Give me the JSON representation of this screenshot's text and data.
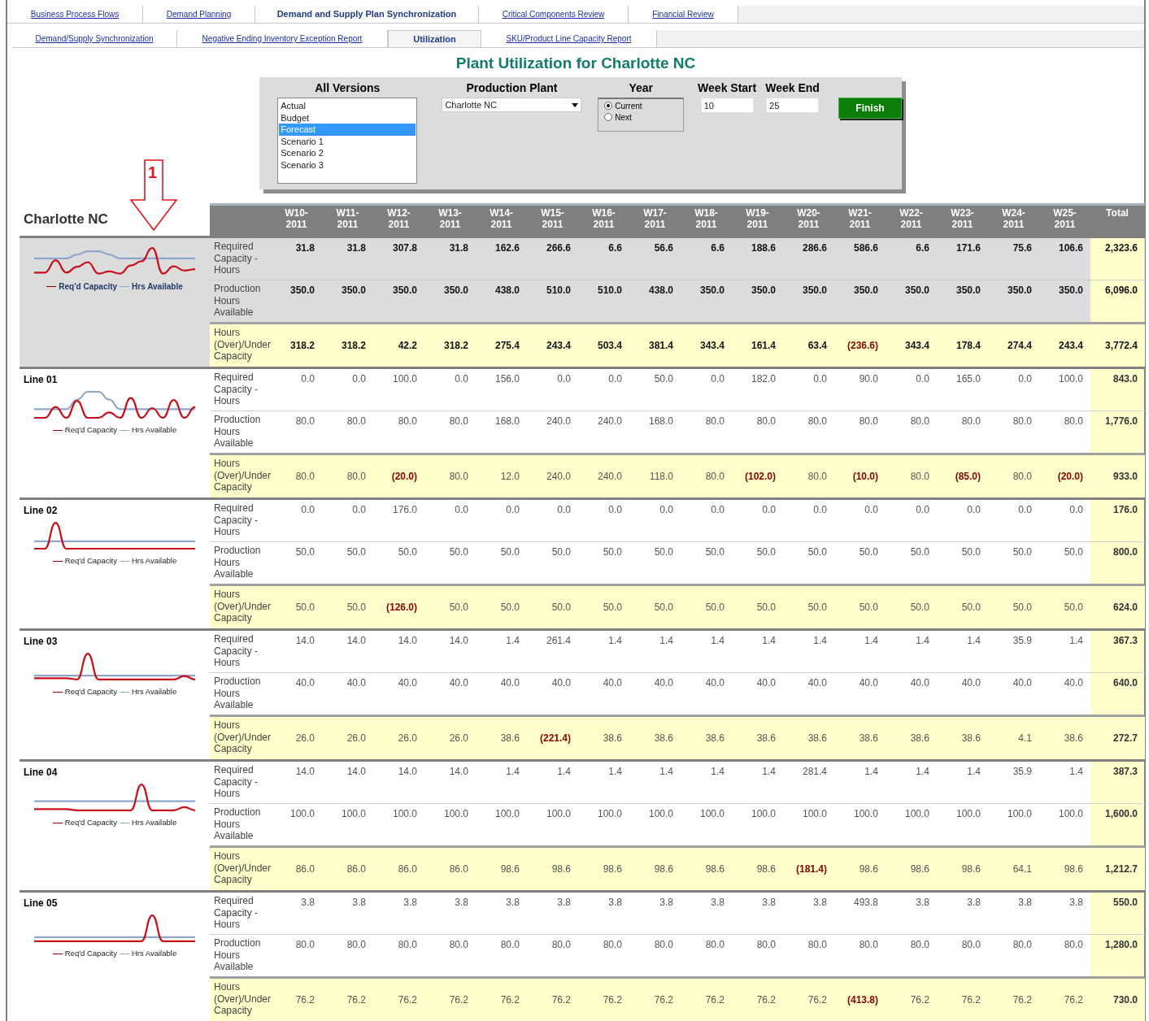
{
  "tabs_primary": [
    {
      "label": "Business Process Flows",
      "selected": false
    },
    {
      "label": "Demand Planning",
      "selected": false
    },
    {
      "label": "Demand and Supply Plan Synchronization",
      "selected": true
    },
    {
      "label": "Critical Components Review",
      "selected": false
    },
    {
      "label": "Financial Review",
      "selected": false
    }
  ],
  "tabs_secondary": [
    {
      "label": "Demand/Supply Synchronization",
      "selected": false
    },
    {
      "label": "Negative Ending Inventory Exception Report",
      "selected": false
    },
    {
      "label": "Utilization",
      "selected": true
    },
    {
      "label": "SKU/Product Line Capacity Report",
      "selected": false
    }
  ],
  "page_title": "Plant Utilization for Charlotte NC",
  "filters": {
    "versions": {
      "label": "All Versions",
      "items": [
        {
          "label": "Actual",
          "selected": false
        },
        {
          "label": "Budget",
          "selected": false
        },
        {
          "label": "Forecast",
          "selected": true
        },
        {
          "label": "Scenario 1",
          "selected": false
        },
        {
          "label": "Scenario 2",
          "selected": false
        },
        {
          "label": "Scenario 3",
          "selected": false
        }
      ]
    },
    "plant": {
      "label": "Production Plant",
      "value": "Charlotte NC"
    },
    "year": {
      "label": "Year",
      "options": [
        {
          "label": "Current",
          "selected": true
        },
        {
          "label": "Next",
          "selected": false
        }
      ]
    },
    "week_start": {
      "label": "Week Start",
      "value": "10"
    },
    "week_end": {
      "label": "Week End",
      "value": "25"
    },
    "finish_button": "Finish"
  },
  "callout": {
    "label": "1"
  },
  "table": {
    "title": "Charlotte NC",
    "columns": [
      "W10-2011",
      "W11-2011",
      "W12-2011",
      "W13-2011",
      "W14-2011",
      "W15-2011",
      "W16-2011",
      "W17-2011",
      "W18-2011",
      "W19-2011",
      "W20-2011",
      "W21-2011",
      "W22-2011",
      "W23-2011",
      "W24-2011",
      "W25-2011",
      "Total"
    ],
    "groups": [
      {
        "kind": "plant",
        "legend": [
          "Req'd Capacity",
          "Hrs Available"
        ],
        "rows": [
          {
            "kind": "required",
            "label": "Required Capacity - Hours",
            "values": [
              "31.8",
              "31.8",
              "307.8",
              "31.8",
              "162.6",
              "266.6",
              "6.6",
              "56.6",
              "6.6",
              "188.6",
              "286.6",
              "586.6",
              "6.6",
              "171.6",
              "75.6",
              "106.6"
            ],
            "total": "2,323.6"
          },
          {
            "kind": "available",
            "label": "Production Hours Available",
            "values": [
              "350.0",
              "350.0",
              "350.0",
              "350.0",
              "438.0",
              "510.0",
              "510.0",
              "438.0",
              "350.0",
              "350.0",
              "350.0",
              "350.0",
              "350.0",
              "350.0",
              "350.0",
              "350.0"
            ],
            "total": "6,096.0"
          },
          {
            "kind": "balance",
            "label": "Hours (Over)/Under Capacity",
            "cells": [
              {
                "v": "318.2",
                "over": false
              },
              {
                "v": "318.2",
                "over": false
              },
              {
                "v": "42.2",
                "over": false
              },
              {
                "v": "318.2",
                "over": false
              },
              {
                "v": "275.4",
                "over": false
              },
              {
                "v": "243.4",
                "over": false
              },
              {
                "v": "503.4",
                "over": false
              },
              {
                "v": "381.4",
                "over": false
              },
              {
                "v": "343.4",
                "over": false
              },
              {
                "v": "161.4",
                "over": false
              },
              {
                "v": "63.4",
                "over": false
              },
              {
                "v": "(236.6)",
                "over": true
              },
              {
                "v": "343.4",
                "over": false
              },
              {
                "v": "178.4",
                "over": false
              },
              {
                "v": "274.4",
                "over": false
              },
              {
                "v": "243.4",
                "over": false
              }
            ],
            "total": "3,772.4"
          }
        ]
      },
      {
        "kind": "line",
        "name": "Line 01",
        "legend": [
          "Req'd Capacity",
          "Hrs Available"
        ],
        "rows": [
          {
            "kind": "required",
            "label": "Required Capacity - Hours",
            "values": [
              "0.0",
              "0.0",
              "100.0",
              "0.0",
              "156.0",
              "0.0",
              "0.0",
              "50.0",
              "0.0",
              "182.0",
              "0.0",
              "90.0",
              "0.0",
              "165.0",
              "0.0",
              "100.0"
            ],
            "total": "843.0"
          },
          {
            "kind": "available",
            "label": "Production Hours Available",
            "values": [
              "80.0",
              "80.0",
              "80.0",
              "80.0",
              "168.0",
              "240.0",
              "240.0",
              "168.0",
              "80.0",
              "80.0",
              "80.0",
              "80.0",
              "80.0",
              "80.0",
              "80.0",
              "80.0"
            ],
            "total": "1,776.0"
          },
          {
            "kind": "balance",
            "label": "Hours (Over)/Under Capacity",
            "cells": [
              {
                "v": "80.0",
                "over": false
              },
              {
                "v": "80.0",
                "over": false
              },
              {
                "v": "(20.0)",
                "over": true
              },
              {
                "v": "80.0",
                "over": false
              },
              {
                "v": "12.0",
                "over": false
              },
              {
                "v": "240.0",
                "over": false
              },
              {
                "v": "240.0",
                "over": false
              },
              {
                "v": "118.0",
                "over": false
              },
              {
                "v": "80.0",
                "over": false
              },
              {
                "v": "(102.0)",
                "over": true
              },
              {
                "v": "80.0",
                "over": false
              },
              {
                "v": "(10.0)",
                "over": true
              },
              {
                "v": "80.0",
                "over": false
              },
              {
                "v": "(85.0)",
                "over": true
              },
              {
                "v": "80.0",
                "over": false
              },
              {
                "v": "(20.0)",
                "over": true
              }
            ],
            "total": "933.0"
          }
        ]
      },
      {
        "kind": "line",
        "name": "Line 02",
        "legend": [
          "Req'd Capacity",
          "Hrs Available"
        ],
        "rows": [
          {
            "kind": "required",
            "label": "Required Capacity - Hours",
            "values": [
              "0.0",
              "0.0",
              "176.0",
              "0.0",
              "0.0",
              "0.0",
              "0.0",
              "0.0",
              "0.0",
              "0.0",
              "0.0",
              "0.0",
              "0.0",
              "0.0",
              "0.0",
              "0.0"
            ],
            "total": "176.0"
          },
          {
            "kind": "available",
            "label": "Production Hours Available",
            "values": [
              "50.0",
              "50.0",
              "50.0",
              "50.0",
              "50.0",
              "50.0",
              "50.0",
              "50.0",
              "50.0",
              "50.0",
              "50.0",
              "50.0",
              "50.0",
              "50.0",
              "50.0",
              "50.0"
            ],
            "total": "800.0"
          },
          {
            "kind": "balance",
            "label": "Hours (Over)/Under Capacity",
            "cells": [
              {
                "v": "50.0",
                "over": false
              },
              {
                "v": "50.0",
                "over": false
              },
              {
                "v": "(126.0)",
                "over": true
              },
              {
                "v": "50.0",
                "over": false
              },
              {
                "v": "50.0",
                "over": false
              },
              {
                "v": "50.0",
                "over": false
              },
              {
                "v": "50.0",
                "over": false
              },
              {
                "v": "50.0",
                "over": false
              },
              {
                "v": "50.0",
                "over": false
              },
              {
                "v": "50.0",
                "over": false
              },
              {
                "v": "50.0",
                "over": false
              },
              {
                "v": "50.0",
                "over": false
              },
              {
                "v": "50.0",
                "over": false
              },
              {
                "v": "50.0",
                "over": false
              },
              {
                "v": "50.0",
                "over": false
              },
              {
                "v": "50.0",
                "over": false
              }
            ],
            "total": "624.0"
          }
        ]
      },
      {
        "kind": "line",
        "name": "Line 03",
        "legend": [
          "Req'd Capacity",
          "Hrs Available"
        ],
        "rows": [
          {
            "kind": "required",
            "label": "Required Capacity - Hours",
            "values": [
              "14.0",
              "14.0",
              "14.0",
              "14.0",
              "1.4",
              "261.4",
              "1.4",
              "1.4",
              "1.4",
              "1.4",
              "1.4",
              "1.4",
              "1.4",
              "1.4",
              "35.9",
              "1.4"
            ],
            "total": "367.3"
          },
          {
            "kind": "available",
            "label": "Production Hours Available",
            "values": [
              "40.0",
              "40.0",
              "40.0",
              "40.0",
              "40.0",
              "40.0",
              "40.0",
              "40.0",
              "40.0",
              "40.0",
              "40.0",
              "40.0",
              "40.0",
              "40.0",
              "40.0",
              "40.0"
            ],
            "total": "640.0"
          },
          {
            "kind": "balance",
            "label": "Hours (Over)/Under Capacity",
            "cells": [
              {
                "v": "26.0",
                "over": false
              },
              {
                "v": "26.0",
                "over": false
              },
              {
                "v": "26.0",
                "over": false
              },
              {
                "v": "26.0",
                "over": false
              },
              {
                "v": "38.6",
                "over": false
              },
              {
                "v": "(221.4)",
                "over": true
              },
              {
                "v": "38.6",
                "over": false
              },
              {
                "v": "38.6",
                "over": false
              },
              {
                "v": "38.6",
                "over": false
              },
              {
                "v": "38.6",
                "over": false
              },
              {
                "v": "38.6",
                "over": false
              },
              {
                "v": "38.6",
                "over": false
              },
              {
                "v": "38.6",
                "over": false
              },
              {
                "v": "38.6",
                "over": false
              },
              {
                "v": "4.1",
                "over": false
              },
              {
                "v": "38.6",
                "over": false
              }
            ],
            "total": "272.7"
          }
        ]
      },
      {
        "kind": "line",
        "name": "Line 04",
        "legend": [
          "Req'd Capacity",
          "Hrs Available"
        ],
        "rows": [
          {
            "kind": "required",
            "label": "Required Capacity - Hours",
            "values": [
              "14.0",
              "14.0",
              "14.0",
              "14.0",
              "1.4",
              "1.4",
              "1.4",
              "1.4",
              "1.4",
              "1.4",
              "281.4",
              "1.4",
              "1.4",
              "1.4",
              "35.9",
              "1.4"
            ],
            "total": "387.3"
          },
          {
            "kind": "available",
            "label": "Production Hours Available",
            "values": [
              "100.0",
              "100.0",
              "100.0",
              "100.0",
              "100.0",
              "100.0",
              "100.0",
              "100.0",
              "100.0",
              "100.0",
              "100.0",
              "100.0",
              "100.0",
              "100.0",
              "100.0",
              "100.0"
            ],
            "total": "1,600.0"
          },
          {
            "kind": "balance",
            "label": "Hours (Over)/Under Capacity",
            "cells": [
              {
                "v": "86.0",
                "over": false
              },
              {
                "v": "86.0",
                "over": false
              },
              {
                "v": "86.0",
                "over": false
              },
              {
                "v": "86.0",
                "over": false
              },
              {
                "v": "98.6",
                "over": false
              },
              {
                "v": "98.6",
                "over": false
              },
              {
                "v": "98.6",
                "over": false
              },
              {
                "v": "98.6",
                "over": false
              },
              {
                "v": "98.6",
                "over": false
              },
              {
                "v": "98.6",
                "over": false
              },
              {
                "v": "(181.4)",
                "over": true
              },
              {
                "v": "98.6",
                "over": false
              },
              {
                "v": "98.6",
                "over": false
              },
              {
                "v": "98.6",
                "over": false
              },
              {
                "v": "64.1",
                "over": false
              },
              {
                "v": "98.6",
                "over": false
              }
            ],
            "total": "1,212.7"
          }
        ]
      },
      {
        "kind": "line",
        "name": "Line 05",
        "legend": [
          "Req'd Capacity",
          "Hrs Available"
        ],
        "rows": [
          {
            "kind": "required",
            "label": "Required Capacity - Hours",
            "values": [
              "3.8",
              "3.8",
              "3.8",
              "3.8",
              "3.8",
              "3.8",
              "3.8",
              "3.8",
              "3.8",
              "3.8",
              "3.8",
              "493.8",
              "3.8",
              "3.8",
              "3.8",
              "3.8"
            ],
            "total": "550.0"
          },
          {
            "kind": "available",
            "label": "Production Hours Available",
            "values": [
              "80.0",
              "80.0",
              "80.0",
              "80.0",
              "80.0",
              "80.0",
              "80.0",
              "80.0",
              "80.0",
              "80.0",
              "80.0",
              "80.0",
              "80.0",
              "80.0",
              "80.0",
              "80.0"
            ],
            "total": "1,280.0"
          },
          {
            "kind": "balance",
            "label": "Hours (Over)/Under Capacity",
            "cells": [
              {
                "v": "76.2",
                "over": false
              },
              {
                "v": "76.2",
                "over": false
              },
              {
                "v": "76.2",
                "over": false
              },
              {
                "v": "76.2",
                "over": false
              },
              {
                "v": "76.2",
                "over": false
              },
              {
                "v": "76.2",
                "over": false
              },
              {
                "v": "76.2",
                "over": false
              },
              {
                "v": "76.2",
                "over": false
              },
              {
                "v": "76.2",
                "over": false
              },
              {
                "v": "76.2",
                "over": false
              },
              {
                "v": "76.2",
                "over": false
              },
              {
                "v": "(413.8)",
                "over": true
              },
              {
                "v": "76.2",
                "over": false
              },
              {
                "v": "76.2",
                "over": false
              },
              {
                "v": "76.2",
                "over": false
              },
              {
                "v": "76.2",
                "over": false
              }
            ],
            "total": "730.0"
          }
        ]
      }
    ]
  }
}
